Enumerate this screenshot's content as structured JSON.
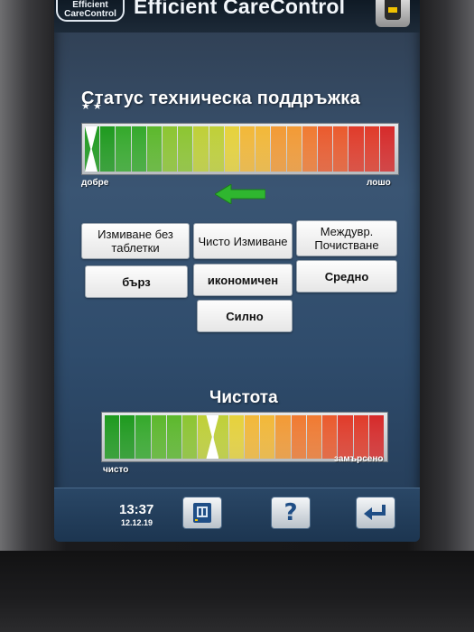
{
  "header": {
    "logo_line1": "Efficient",
    "logo_line2": "CareControl",
    "title": "Efficient CareControl"
  },
  "maintenance": {
    "title": "Статус техническа поддръжка",
    "stars": "★ ★",
    "label_good": "добре",
    "label_bad": "лошо",
    "level": 0.0
  },
  "buttons": {
    "wash_no_tablet": "Измиване без таблетки",
    "clean_wash": "Чисто Измиване",
    "intermediate_clean": "Междувр. Почистване",
    "fast": "бърз",
    "economic": "икономичен",
    "medium": "Средно",
    "strong": "Силно"
  },
  "cleanliness": {
    "title": "Чистота",
    "label_clean": "чисто",
    "label_dirty": "замърсено",
    "level": 0.38
  },
  "footer": {
    "time": "13:37",
    "date": "12.12.19",
    "help": "?"
  },
  "icons": {
    "device": "appliance-icon",
    "arrow": "arrow-left-icon",
    "oven": "oven-icon",
    "help": "question-icon",
    "back": "return-icon"
  },
  "colors": {
    "arrow_green": "#2fb62f",
    "meter_gradient": [
      "#1e9a1e",
      "#34a92b",
      "#5cb82c",
      "#8cc531",
      "#bfd037",
      "#e6d23b",
      "#f2b838",
      "#f29a35",
      "#f07a31",
      "#ea5a2d",
      "#e03b2a",
      "#d62a2a"
    ]
  }
}
